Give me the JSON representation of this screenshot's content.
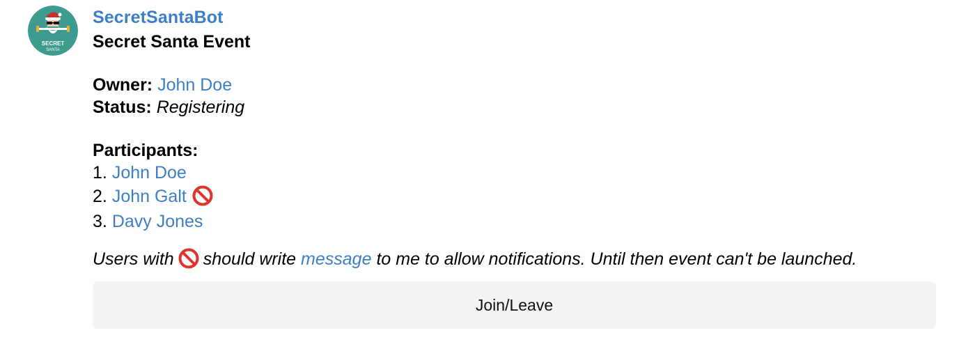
{
  "bot": {
    "name": "SecretSantaBot",
    "avatar_icon": "secret-santa-avatar",
    "avatar_text_line1": "SECRET",
    "avatar_text_line2": "SANTA"
  },
  "event": {
    "title": "Secret Santa Event",
    "owner_label": "Owner:",
    "owner_name": "John Doe",
    "status_label": "Status:",
    "status_value": "Registering"
  },
  "participants": {
    "label": "Participants:",
    "items": [
      {
        "number": "1.",
        "name": "John Doe",
        "blocked": false
      },
      {
        "number": "2.",
        "name": "John Galt",
        "blocked": true
      },
      {
        "number": "3.",
        "name": "Davy Jones",
        "blocked": false
      }
    ]
  },
  "note": {
    "before_icon": "Users with",
    "after_icon": "should write",
    "link_text": "message",
    "after_link": "to me to allow notifications. Until then event can't be launched.",
    "icon": "prohibited-icon"
  },
  "button": {
    "label": "Join/Leave"
  },
  "colors": {
    "link": "#3d7fc6",
    "button_bg": "#f3f3f3",
    "avatar_bg": "#3e9c8f",
    "prohibited": "#e0342c"
  }
}
